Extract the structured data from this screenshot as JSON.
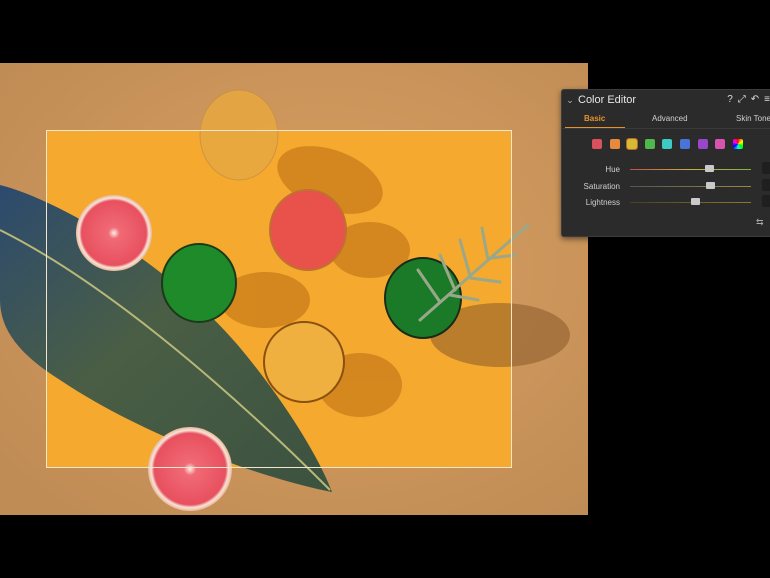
{
  "panel": {
    "title": "Color Editor",
    "icons": [
      "help-icon",
      "expand-icon",
      "undo-icon",
      "menu-icon"
    ],
    "help_glyph": "?",
    "tabs": [
      {
        "label": "Basic",
        "active": true
      },
      {
        "label": "Advanced",
        "active": false
      },
      {
        "label": "Skin Tone",
        "active": false
      }
    ],
    "swatches": [
      {
        "name": "red",
        "color": "#d9505f"
      },
      {
        "name": "orange",
        "color": "#e58a3f"
      },
      {
        "name": "yellow",
        "color": "#d6b93a",
        "selected": true
      },
      {
        "name": "green",
        "color": "#4fb84b"
      },
      {
        "name": "cyan",
        "color": "#3fc9c4"
      },
      {
        "name": "blue",
        "color": "#4a73d8"
      },
      {
        "name": "purple",
        "color": "#9a46c9"
      },
      {
        "name": "magenta",
        "color": "#d653b0"
      },
      {
        "name": "all-colors",
        "color": "#ffffff"
      }
    ],
    "sliders": [
      {
        "label": "Hue",
        "value": 0.65
      },
      {
        "label": "Saturation",
        "value": 0.66
      },
      {
        "label": "Lightness",
        "value": 0.54
      }
    ]
  },
  "colors": {
    "accent": "#e8922b",
    "panel_bg": "#2b2b2b",
    "backdrop": "#c99a62",
    "crop_inner": "#f6ad2f"
  }
}
